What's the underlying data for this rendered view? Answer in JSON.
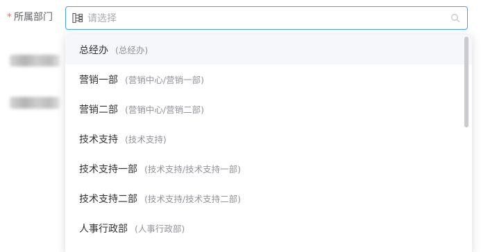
{
  "form": {
    "required_mark": "*",
    "label": "所属部门"
  },
  "select": {
    "placeholder": "请选择",
    "prefix_icon": "tree-structure-icon",
    "suffix_icon": "search-icon",
    "accent_color": "#409eff"
  },
  "dropdown": {
    "options": [
      {
        "name": "总经办",
        "path": "(总经办)"
      },
      {
        "name": "营销一部",
        "path": "(营销中心/营销一部)"
      },
      {
        "name": "营销二部",
        "path": "(营销中心/营销二部)"
      },
      {
        "name": "技术支持",
        "path": "(技术支持)"
      },
      {
        "name": "技术支持一部",
        "path": "(技术支持/技术支持一部)"
      },
      {
        "name": "技术支持二部",
        "path": "(技术支持/技术支持二部)"
      },
      {
        "name": "人事行政部",
        "path": "(人事行政部)"
      }
    ]
  }
}
